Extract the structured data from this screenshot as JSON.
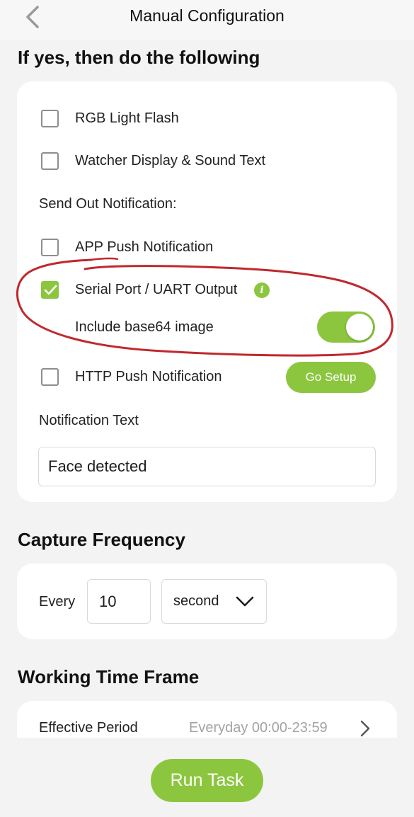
{
  "header": {
    "title": "Manual Configuration",
    "back_icon": "chevron-left-icon"
  },
  "actions_section": {
    "title": "If yes, then do the following",
    "rgb_light_flash": {
      "label": "RGB Light Flash",
      "checked": false
    },
    "watcher_display": {
      "label": "Watcher Display & Sound Text",
      "checked": false
    },
    "send_out_label": "Send Out Notification:",
    "app_push": {
      "label": "APP Push Notification",
      "checked": false
    },
    "serial_port": {
      "label": "Serial Port / UART Output",
      "checked": true,
      "info_icon": "i"
    },
    "include_base64": {
      "label": "Include base64 image",
      "enabled": true
    },
    "http_push": {
      "label": "HTTP Push Notification",
      "checked": false,
      "setup_button": "Go Setup"
    },
    "notification_text_label": "Notification Text",
    "notification_text_value": "Face detected"
  },
  "capture_frequency": {
    "title": "Capture Frequency",
    "every_label": "Every",
    "value": "10",
    "unit": "second"
  },
  "working_time_frame": {
    "title": "Working Time Frame",
    "effective_period_label": "Effective Period",
    "effective_period_value": "Everyday 00:00-23:59"
  },
  "run_task_label": "Run Task",
  "colors": {
    "accent": "#8cc63f",
    "annotation": "#c0282d",
    "background": "#f3f3f4",
    "card": "#ffffff"
  }
}
